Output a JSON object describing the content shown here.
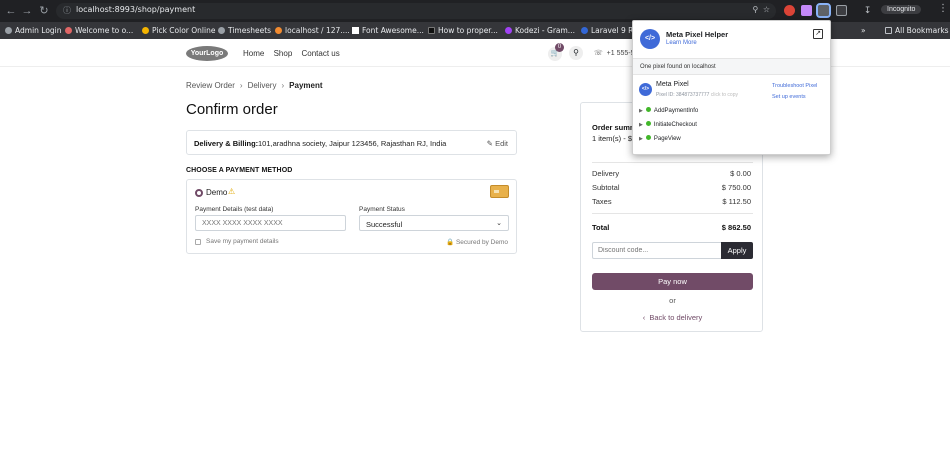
{
  "browser": {
    "url": "localhost:8993/shop/payment",
    "incognito_label": "Incognito",
    "all_bookmarks_label": "All Bookmarks",
    "bookmarks": [
      {
        "label": "Admin Login",
        "icon": "globe-icon",
        "color": "#9aa0a6"
      },
      {
        "label": "Welcome to o...",
        "icon": "odoo-icon",
        "color": "#e06666"
      },
      {
        "label": "Pick Color Online",
        "icon": "color-wheel-icon",
        "color": "#f4b400"
      },
      {
        "label": "Timesheets",
        "icon": "globe-icon",
        "color": "#9aa0a6"
      },
      {
        "label": "localhost / 127....",
        "icon": "phpmyadmin-icon",
        "color": "#f28b30"
      },
      {
        "label": "Font Awesome...",
        "icon": "flag-icon",
        "color": "#ffffff"
      },
      {
        "label": "How to proper...",
        "icon": "dev-icon",
        "color": "#222222"
      },
      {
        "label": "Kodezi - Gram...",
        "icon": "kodezi-icon",
        "color": "#a142f4"
      },
      {
        "label": "Laravel 9 Rl...",
        "icon": "laravel-icon",
        "color": "#3367d6"
      }
    ]
  },
  "site": {
    "logo_text": "YourLogo",
    "nav": [
      "Home",
      "Shop",
      "Contact us"
    ],
    "cart_count": "0",
    "phone": "+1 555-5"
  },
  "checkout": {
    "breadcrumb": [
      "Review Order",
      "Delivery",
      "Payment"
    ],
    "title": "Confirm order",
    "billing_label": "Delivery & Billing:",
    "billing_value": "101,aradhna society, Jaipur 123456, Rajasthan RJ, India",
    "edit_label": "Edit",
    "payment_heading": "CHOOSE A PAYMENT METHOD",
    "method_name": "Demo",
    "payment_details_label": "Payment Details (test data)",
    "payment_details_placeholder": "XXXX XXXX XXXX XXXX",
    "payment_status_label": "Payment Status",
    "payment_status_value": "Successful",
    "save_details_label": "Save my payment details",
    "secured_label": "Secured by Demo"
  },
  "summary": {
    "title": "Order summ",
    "items": "1 item(s) -  $",
    "delivery_label": "Delivery",
    "delivery_value": "$ 0.00",
    "subtotal_label": "Subtotal",
    "subtotal_value": "$ 750.00",
    "taxes_label": "Taxes",
    "taxes_value": "$ 112.50",
    "total_label": "Total",
    "total_value": "$ 862.50",
    "discount_placeholder": "Discount code...",
    "apply_label": "Apply",
    "pay_label": "Pay now",
    "or_label": "or",
    "back_label": "Back to delivery"
  },
  "pixel_helper": {
    "title": "Meta Pixel Helper",
    "learn_more": "Learn More",
    "found_text": "One pixel found on localhost",
    "pixel_name": "Meta Pixel",
    "pixel_id": "Pixel ID: 384873737777",
    "click_to_copy": "click to copy",
    "troubleshoot": "Troubleshoot Pixel",
    "setup_events": "Set up events",
    "events": [
      "AddPaymentInfo",
      "InitiateCheckout",
      "PageView"
    ]
  },
  "colors": {
    "brand": "#714b67",
    "meta_blue": "#3f6ad8",
    "event_ok": "#42b72a"
  }
}
